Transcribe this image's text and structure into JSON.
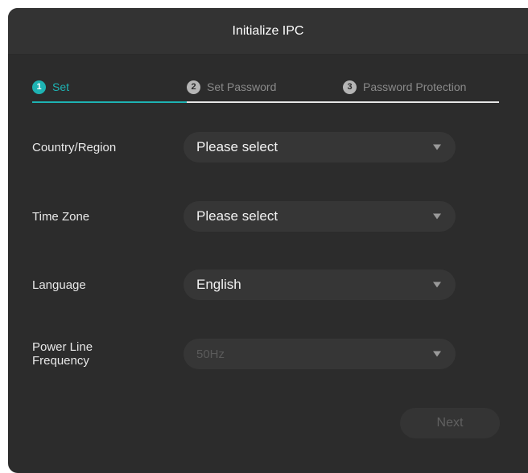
{
  "dialog": {
    "title": "Initialize IPC"
  },
  "steps": [
    {
      "number": "1",
      "label": "Set",
      "state": "active"
    },
    {
      "number": "2",
      "label": "Set Password",
      "state": "inactive"
    },
    {
      "number": "3",
      "label": "Password Protection",
      "state": "inactive"
    }
  ],
  "form": {
    "country": {
      "label": "Country/Region",
      "value": "Please select"
    },
    "time_zone": {
      "label": "Time Zone",
      "value": "Please select"
    },
    "language": {
      "label": "Language",
      "value": "English"
    },
    "power_line": {
      "label_line1": "Power Line",
      "label_line2": "Frequency",
      "value": "50Hz",
      "disabled": true
    }
  },
  "actions": {
    "next_label": "Next"
  },
  "colors": {
    "accent": "#1eb3b3",
    "background": "#2c2c2c",
    "header": "#333333"
  }
}
